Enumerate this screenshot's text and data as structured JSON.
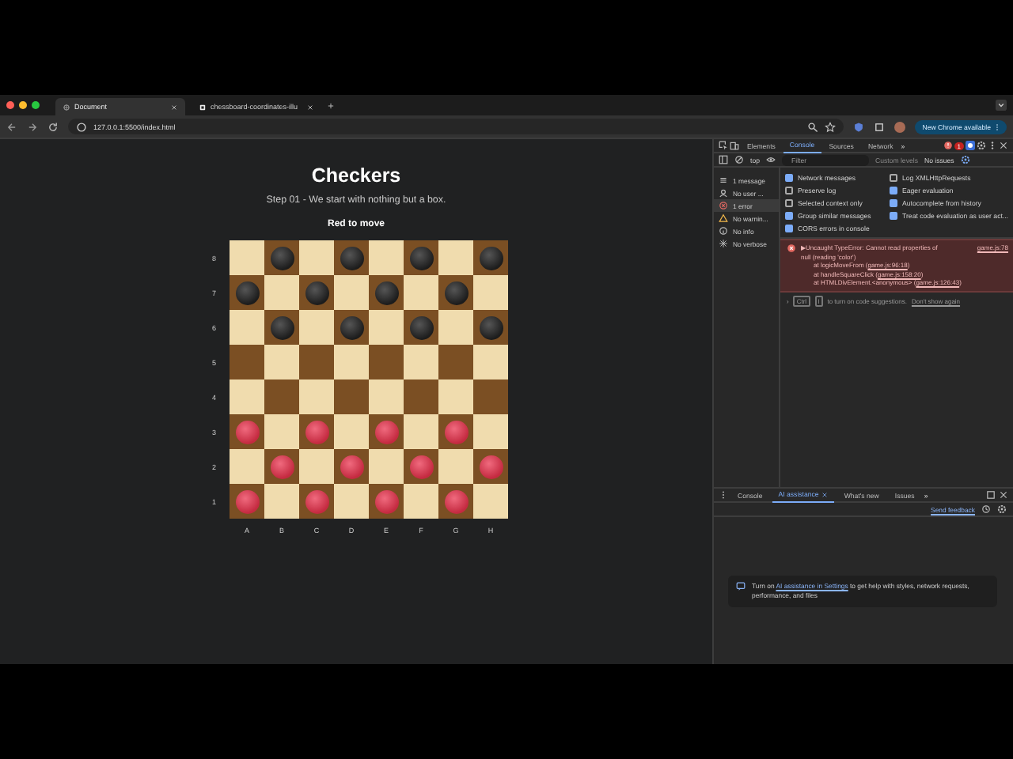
{
  "browser": {
    "tabs": [
      {
        "title": "Document",
        "selected": true
      },
      {
        "title": "chessboard-coordinates-illu",
        "selected": false
      }
    ],
    "url": "127.0.0.1:5500/index.html",
    "update_button": "New Chrome available"
  },
  "page": {
    "title": "Checkers",
    "subtitle": "Step 01 - We start with nothing but a box.",
    "status": "Red to move",
    "ranks": [
      "8",
      "7",
      "6",
      "5",
      "4",
      "3",
      "2",
      "1"
    ],
    "files": [
      "A",
      "B",
      "C",
      "D",
      "E",
      "F",
      "G",
      "H"
    ],
    "board": [
      [
        {
          "kind": "empty"
        },
        {
          "kind": "black"
        },
        {
          "kind": "empty"
        },
        {
          "kind": "black"
        },
        {
          "kind": "empty"
        },
        {
          "kind": "black"
        },
        {
          "kind": "empty"
        },
        {
          "kind": "black"
        }
      ],
      [
        {
          "kind": "black"
        },
        {
          "kind": "empty"
        },
        {
          "kind": "black"
        },
        {
          "kind": "empty"
        },
        {
          "kind": "black"
        },
        {
          "kind": "empty"
        },
        {
          "kind": "black"
        },
        {
          "kind": "empty"
        }
      ],
      [
        {
          "kind": "empty"
        },
        {
          "kind": "black"
        },
        {
          "kind": "empty"
        },
        {
          "kind": "black"
        },
        {
          "kind": "empty"
        },
        {
          "kind": "black"
        },
        {
          "kind": "empty"
        },
        {
          "kind": "black"
        }
      ],
      [
        {
          "kind": "empty"
        },
        {
          "kind": "empty"
        },
        {
          "kind": "empty"
        },
        {
          "kind": "empty"
        },
        {
          "kind": "empty"
        },
        {
          "kind": "empty"
        },
        {
          "kind": "empty"
        },
        {
          "kind": "empty"
        }
      ],
      [
        {
          "kind": "empty"
        },
        {
          "kind": "empty"
        },
        {
          "kind": "empty"
        },
        {
          "kind": "empty"
        },
        {
          "kind": "empty"
        },
        {
          "kind": "empty"
        },
        {
          "kind": "empty"
        },
        {
          "kind": "empty"
        }
      ],
      [
        {
          "kind": "red"
        },
        {
          "kind": "empty"
        },
        {
          "kind": "red"
        },
        {
          "kind": "empty"
        },
        {
          "kind": "red"
        },
        {
          "kind": "empty"
        },
        {
          "kind": "red"
        },
        {
          "kind": "empty"
        }
      ],
      [
        {
          "kind": "empty"
        },
        {
          "kind": "red"
        },
        {
          "kind": "empty"
        },
        {
          "kind": "red"
        },
        {
          "kind": "empty"
        },
        {
          "kind": "red"
        },
        {
          "kind": "empty"
        },
        {
          "kind": "red"
        }
      ],
      [
        {
          "kind": "red"
        },
        {
          "kind": "empty"
        },
        {
          "kind": "red"
        },
        {
          "kind": "empty"
        },
        {
          "kind": "red"
        },
        {
          "kind": "empty"
        },
        {
          "kind": "red"
        },
        {
          "kind": "empty"
        }
      ]
    ]
  },
  "devtools": {
    "tabs": [
      {
        "label": "Elements",
        "selected": false
      },
      {
        "label": "Console",
        "selected": true
      },
      {
        "label": "Sources",
        "selected": false
      },
      {
        "label": "Network",
        "selected": false
      }
    ],
    "more": "»",
    "error_count": "1",
    "context": "top",
    "filter_placeholder": "Filter",
    "levels": "Custom levels",
    "issues": "No issues",
    "sidebar": [
      {
        "label": "1 message",
        "kind": "list",
        "selected": false
      },
      {
        "label": "No user ...",
        "kind": "user",
        "selected": false
      },
      {
        "label": "1 error",
        "kind": "error",
        "selected": true
      },
      {
        "label": "No warnin...",
        "kind": "warning",
        "selected": false
      },
      {
        "label": "No info",
        "kind": "info",
        "selected": false
      },
      {
        "label": "No verbose",
        "kind": "verbose",
        "selected": false
      }
    ],
    "settings_left": [
      {
        "label": "Network messages",
        "checked": true
      },
      {
        "label": "Preserve log",
        "checked": false
      },
      {
        "label": "Selected context only",
        "checked": false
      },
      {
        "label": "Group similar messages",
        "checked": true
      },
      {
        "label": "CORS errors in console",
        "checked": true
      }
    ],
    "settings_right": [
      {
        "label": "Log XMLHttpRequests",
        "checked": false
      },
      {
        "label": "Eager evaluation",
        "checked": true
      },
      {
        "label": "Autocomplete from history",
        "checked": true
      },
      {
        "label": "Treat code evaluation as user act...",
        "checked": true
      }
    ],
    "error": {
      "message": "▶Uncaught TypeError: Cannot read properties of",
      "source": "game.js:78",
      "message_2": "null (reading 'color')",
      "stack": [
        {
          "text": "at logicMoveFrom (",
          "link": "game.js:96:18",
          "end": ")"
        },
        {
          "text": "at handleSquareClick (",
          "link": "game.js:158:20",
          "end": ")"
        },
        {
          "text": "at HTMLDivElement.<anonymous> (",
          "link": "game.js:126:43",
          "end": ")"
        }
      ]
    },
    "hint": {
      "prompt": "›",
      "keys": [
        "Ctrl",
        "I"
      ],
      "text": "to turn on code suggestions.",
      "link": "Don't show again"
    },
    "drawer_tabs": [
      {
        "label": "Console",
        "selected": false
      },
      {
        "label": "AI assistance",
        "selected": true
      },
      {
        "label": "What's new",
        "selected": false
      },
      {
        "label": "Issues",
        "selected": false
      }
    ],
    "drawer_more": "»",
    "feedback": "Send feedback",
    "ai_notice": {
      "before": "Turn on ",
      "link": "AI assistance in Settings",
      "after": " to get help with styles, network requests, performance, and files"
    }
  }
}
